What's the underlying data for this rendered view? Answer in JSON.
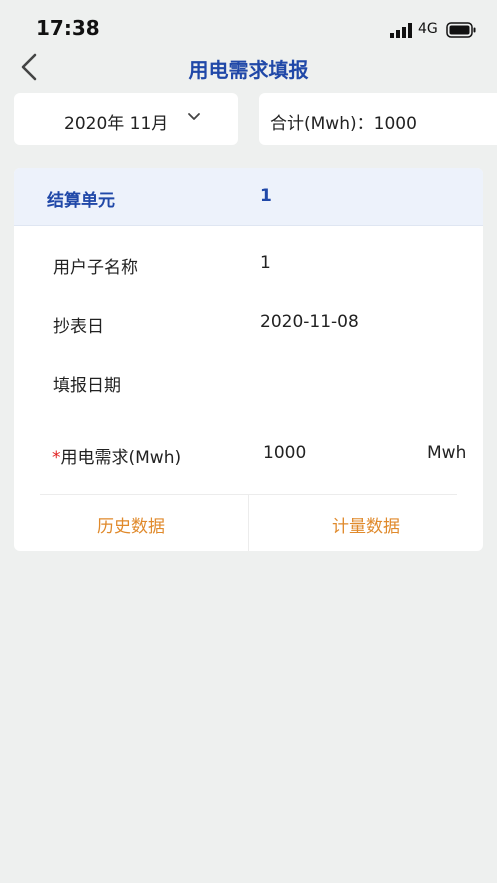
{
  "status_bar": {
    "time": "17:38",
    "network": "4G"
  },
  "header": {
    "title": "用电需求填报"
  },
  "filter": {
    "month": "2020年 11月",
    "total_label": "合计(Mwh)：",
    "total_value": "1000"
  },
  "unit": {
    "label": "结算单元",
    "value": "1"
  },
  "fields": {
    "sub_name_label": "用户子名称",
    "sub_name_value": "1",
    "meter_date_label": "抄表日",
    "meter_date_value": "2020-11-08",
    "fill_date_label": "填报日期",
    "fill_date_value": "",
    "required_mark": "*",
    "demand_label": "用电需求(Mwh)",
    "demand_value": "1000",
    "demand_unit": "Mwh"
  },
  "actions": {
    "history": "历史数据",
    "metering": "计量数据"
  },
  "colors": {
    "primary": "#2048a8",
    "accent": "#e08a2c",
    "required": "#e02020",
    "background": "#eef0ef"
  }
}
